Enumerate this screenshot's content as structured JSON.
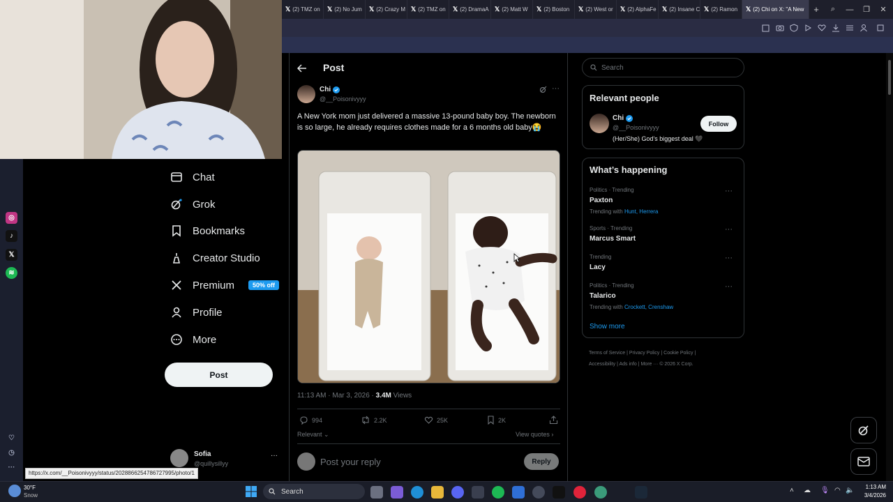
{
  "browser": {
    "tabs": [
      {
        "label": "(2) TMZ on"
      },
      {
        "label": "(2) No Jum"
      },
      {
        "label": "(2) Crazy M"
      },
      {
        "label": "(2) TMZ on"
      },
      {
        "label": "(2) DramaA"
      },
      {
        "label": "(2) Matt W"
      },
      {
        "label": "(2) Boston"
      },
      {
        "label": "(2) West or"
      },
      {
        "label": "(2) AlphaFe"
      },
      {
        "label": "(2) Insane C"
      },
      {
        "label": "(2) Ramon"
      },
      {
        "label": "(2) Chi on X: \"A New"
      }
    ],
    "new_tab": "+",
    "status_url": "https://x.com/__Poisonivyyy/status/2028866254786727995/photo/1"
  },
  "nav": {
    "chat": "Chat",
    "grok": "Grok",
    "bookmarks": "Bookmarks",
    "creator_studio": "Creator Studio",
    "premium": "Premium",
    "premium_badge": "50% off",
    "profile": "Profile",
    "more": "More",
    "post_button": "Post",
    "account": {
      "name": "Sofia",
      "handle": "@quillysillyy"
    }
  },
  "post": {
    "header": "Post",
    "author": {
      "name": "Chi",
      "handle": "@__Poisonivyyy"
    },
    "text": "A New York mom just delivered a massive 13-pound baby boy. The newborn is so large, he already requires clothes made for a 6 months old baby😭",
    "timestamp": "11:13 AM · Mar 3, 2026 · ",
    "views_count": "3.4M",
    "views_label": " Views",
    "stats": {
      "replies": "994",
      "reposts": "2.2K",
      "likes": "25K",
      "bookmarks": "2K"
    },
    "relevant_label": "Relevant",
    "view_quotes": "View quotes",
    "reply_placeholder": "Post your reply",
    "reply_button": "Reply"
  },
  "sidebar": {
    "search_placeholder": "Search",
    "relevant_people": {
      "title": "Relevant people",
      "name": "Chi",
      "handle": "@__Poisonivyyy",
      "bio": "(Her/She) God's biggest deal 🖤",
      "follow": "Follow"
    },
    "happening": {
      "title": "What’s happening",
      "trends": [
        {
          "meta": "Politics · Trending",
          "name": "Paxton",
          "with_label": "Trending with ",
          "with": "Hunt, Herrera"
        },
        {
          "meta": "Sports · Trending",
          "name": "Marcus Smart",
          "with_label": "",
          "with": ""
        },
        {
          "meta": "Trending",
          "name": "Lacy",
          "with_label": "",
          "with": ""
        },
        {
          "meta": "Politics · Trending",
          "name": "Talarico",
          "with_label": "Trending with ",
          "with": "Crockett, Crenshaw"
        }
      ],
      "show_more": "Show more"
    },
    "footer": {
      "terms": "Terms of Service",
      "privacy": "Privacy Policy",
      "cookie": "Cookie Policy",
      "accessibility": "Accessibility",
      "ads": "Ads info",
      "more": "More ···",
      "copyright": "© 2026 X Corp."
    }
  },
  "taskbar": {
    "weather_temp": "30°F",
    "weather_desc": "Snow",
    "search": "Search",
    "time": "1:13 AM",
    "date": "3/4/2026"
  },
  "colors": {
    "accent": "#1d9bf0",
    "bg": "#000000",
    "muted": "#71767b"
  }
}
